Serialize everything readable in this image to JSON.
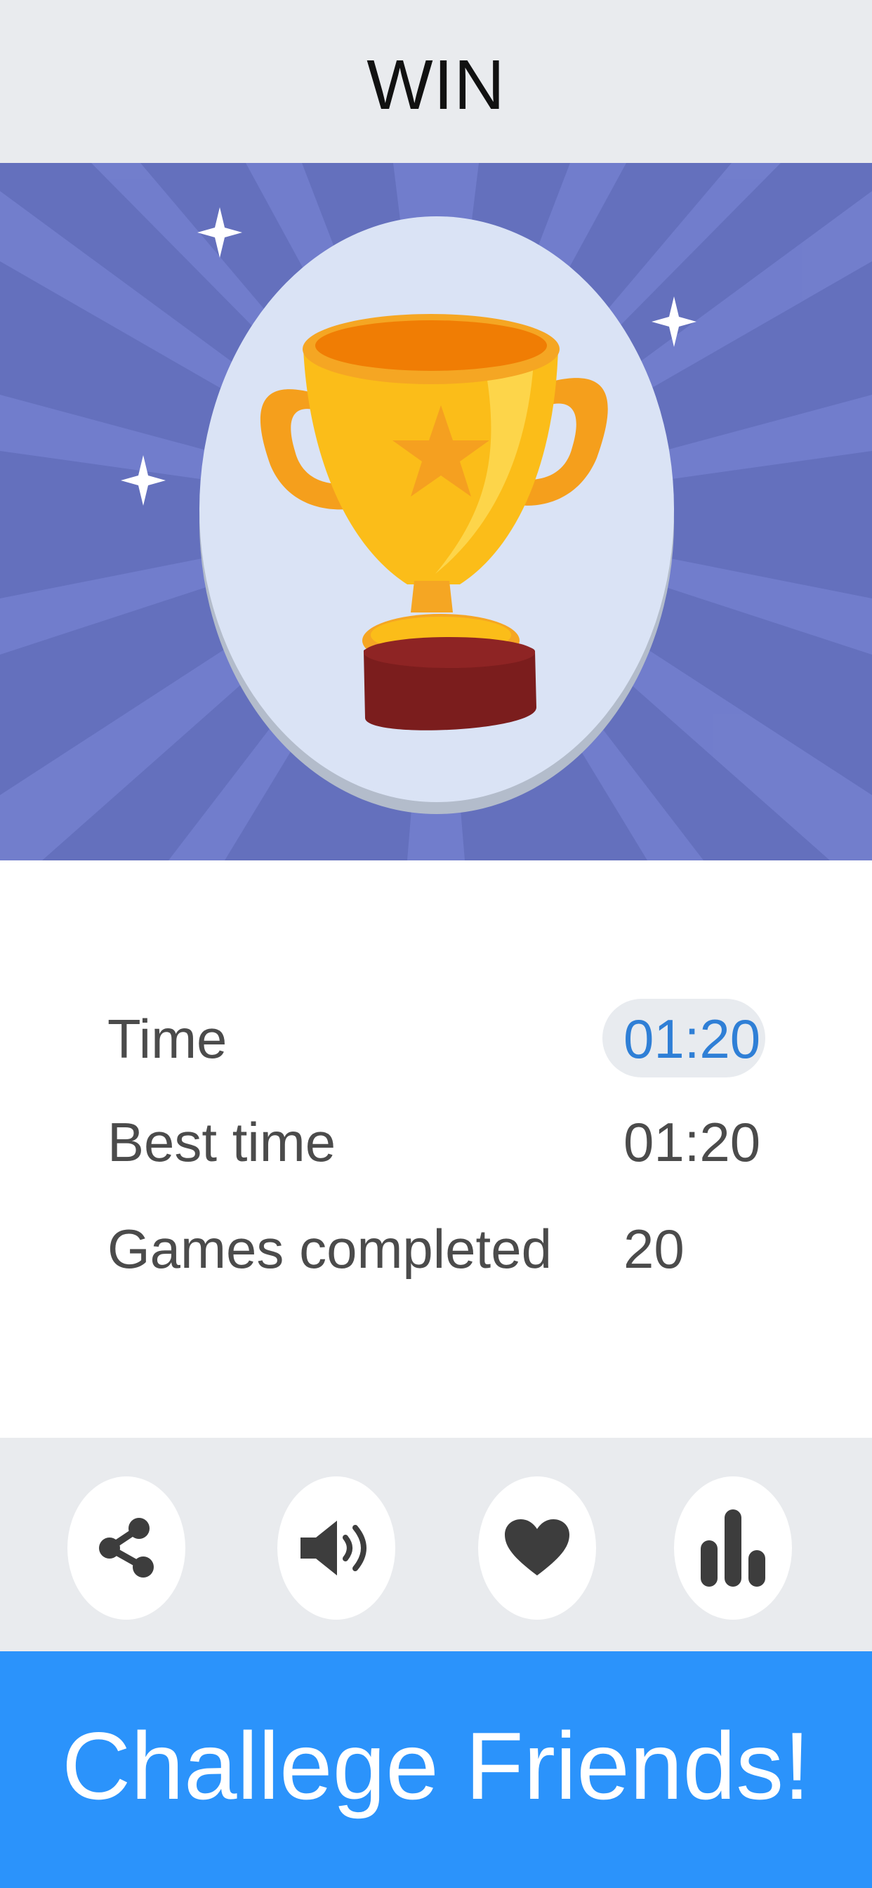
{
  "header": {
    "title": "WIN"
  },
  "stats": [
    {
      "label": "Time",
      "value": "01:20"
    },
    {
      "label": "Best time",
      "value": "01:20"
    },
    {
      "label": "Games completed",
      "value": "20"
    }
  ],
  "toolbar": {
    "buttons": [
      {
        "icon": "share-icon"
      },
      {
        "icon": "sound-icon"
      },
      {
        "icon": "heart-icon"
      },
      {
        "icon": "stats-icon"
      }
    ]
  },
  "cta": {
    "label": "Challege Friends!"
  },
  "colors": {
    "header_bg": "#e9ebee",
    "hero_bg": "#6470bd",
    "highlight": "#2f7fd6",
    "cta_bg": "#2b93fb",
    "icon": "#3d3d3d"
  }
}
